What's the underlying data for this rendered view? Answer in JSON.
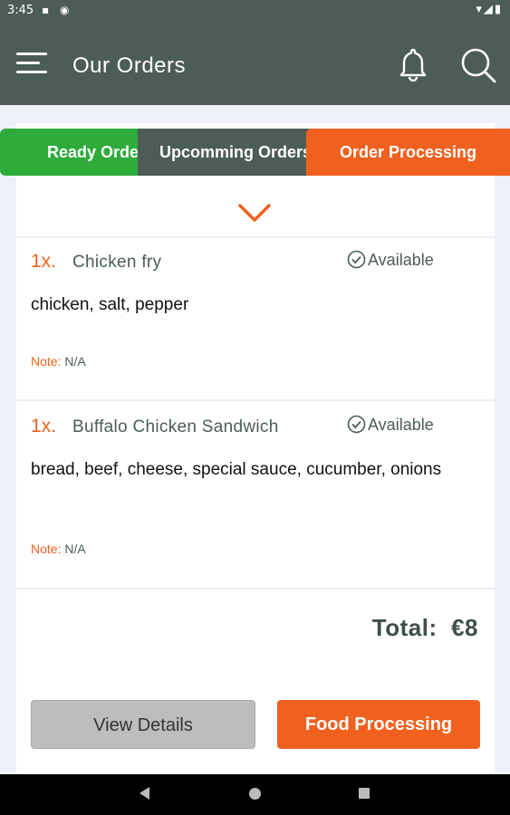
{
  "status_bar": {
    "time": "3:45"
  },
  "app_bar": {
    "title": "Our Orders"
  },
  "tabs": [
    {
      "label": "Ready Orders"
    },
    {
      "label": "Upcomming  Orders"
    },
    {
      "label": "Order Processing"
    }
  ],
  "items": [
    {
      "qty": "1x.",
      "name": "Chicken fry",
      "availability": "Available",
      "ingredients": "chicken, salt, pepper",
      "note_label": "Note:",
      "note_value": "N/A"
    },
    {
      "qty": "1x.",
      "name": "Buffalo Chicken Sandwich",
      "availability": "Available",
      "ingredients": "bread, beef, cheese, special sauce, cucumber, onions",
      "note_label": "Note:",
      "note_value": "N/A"
    }
  ],
  "total": {
    "label": "Total:",
    "value": "€8"
  },
  "buttons": {
    "view_details": "View Details",
    "food_processing": "Food Processing"
  },
  "colors": {
    "header": "#4b5d55",
    "accent": "#f0611f",
    "ready": "#2eab3a"
  },
  "icons": [
    "menu-icon",
    "bell-icon",
    "search-icon",
    "chevron-down-icon",
    "check-circle-icon"
  ]
}
